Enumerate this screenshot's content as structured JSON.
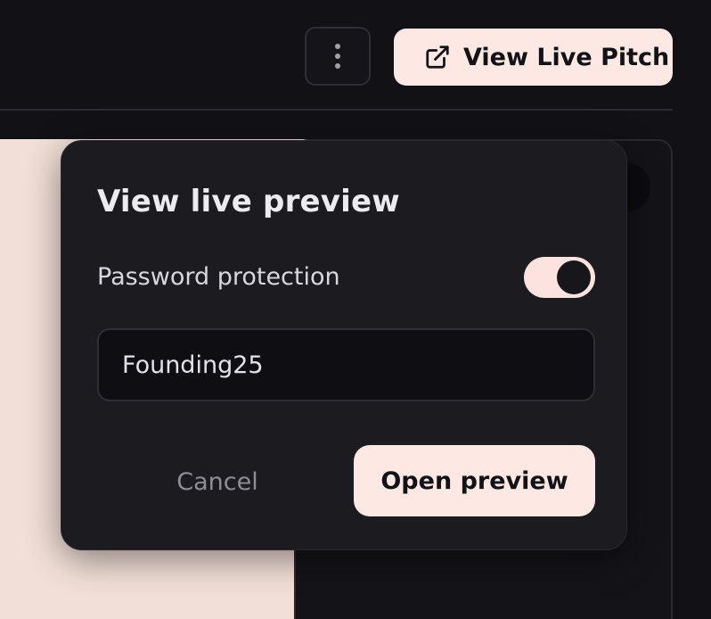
{
  "header": {
    "more_icon": "vertical-dots-icon",
    "view_live_button": {
      "label": "View Live Pitch",
      "icon": "external-link-icon"
    }
  },
  "dialog": {
    "title": "View live preview",
    "password_toggle": {
      "label": "Password protection",
      "enabled": true
    },
    "password_field": {
      "value": "Founding25"
    },
    "cancel_label": "Cancel",
    "open_label": "Open preview"
  },
  "colors": {
    "background": "#121116",
    "dialog_background": "#1c1b20",
    "accent": "#fde8e4",
    "canvas": "#f2e0d8"
  }
}
